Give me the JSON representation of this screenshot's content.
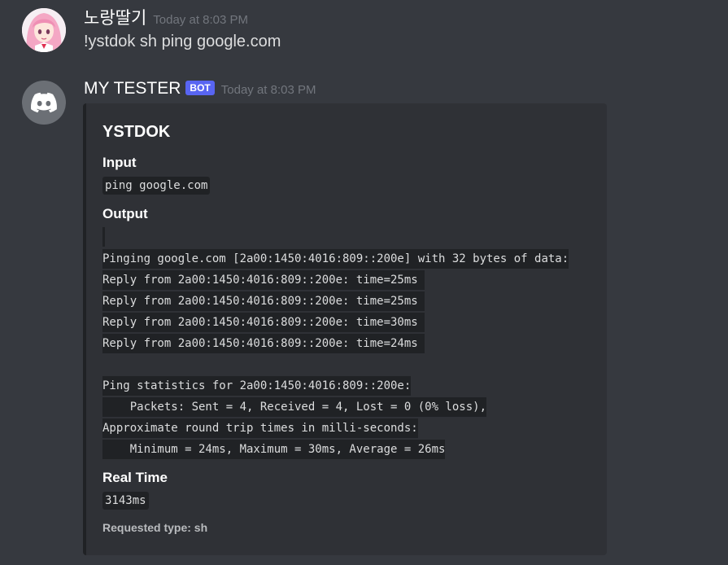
{
  "user_message": {
    "username": "노랑딸기",
    "timestamp": "Today at 8:03 PM",
    "content": "!ystdok sh ping google.com",
    "avatar": "anime-girl-avatar"
  },
  "bot_message": {
    "username": "MY TESTER",
    "bot_tag": "BOT",
    "timestamp": "Today at 8:03 PM",
    "avatar": "discord-logo-icon",
    "embed": {
      "title": "YSTDOK",
      "input_label": "Input",
      "input_value": "ping google.com",
      "output_label": "Output",
      "output_lines": [
        "",
        "Pinging google.com [2a00:1450:4016:809::200e] with 32 bytes of data:",
        "Reply from 2a00:1450:4016:809::200e: time=25ms ",
        "Reply from 2a00:1450:4016:809::200e: time=25ms ",
        "Reply from 2a00:1450:4016:809::200e: time=30ms ",
        "Reply from 2a00:1450:4016:809::200e: time=24ms ",
        "",
        "Ping statistics for 2a00:1450:4016:809::200e:",
        "    Packets: Sent = 4, Received = 4, Lost = 0 (0% loss),",
        "Approximate round trip times in milli-seconds:",
        "    Minimum = 24ms, Maximum = 30ms, Average = 26ms"
      ],
      "realtime_label": "Real Time",
      "realtime_value": "3143ms",
      "footer": "Requested type: sh"
    }
  },
  "colors": {
    "background": "#36393f",
    "embed_bg": "#2f3136",
    "code_bg": "#202225",
    "bot_tag": "#5865f2"
  }
}
